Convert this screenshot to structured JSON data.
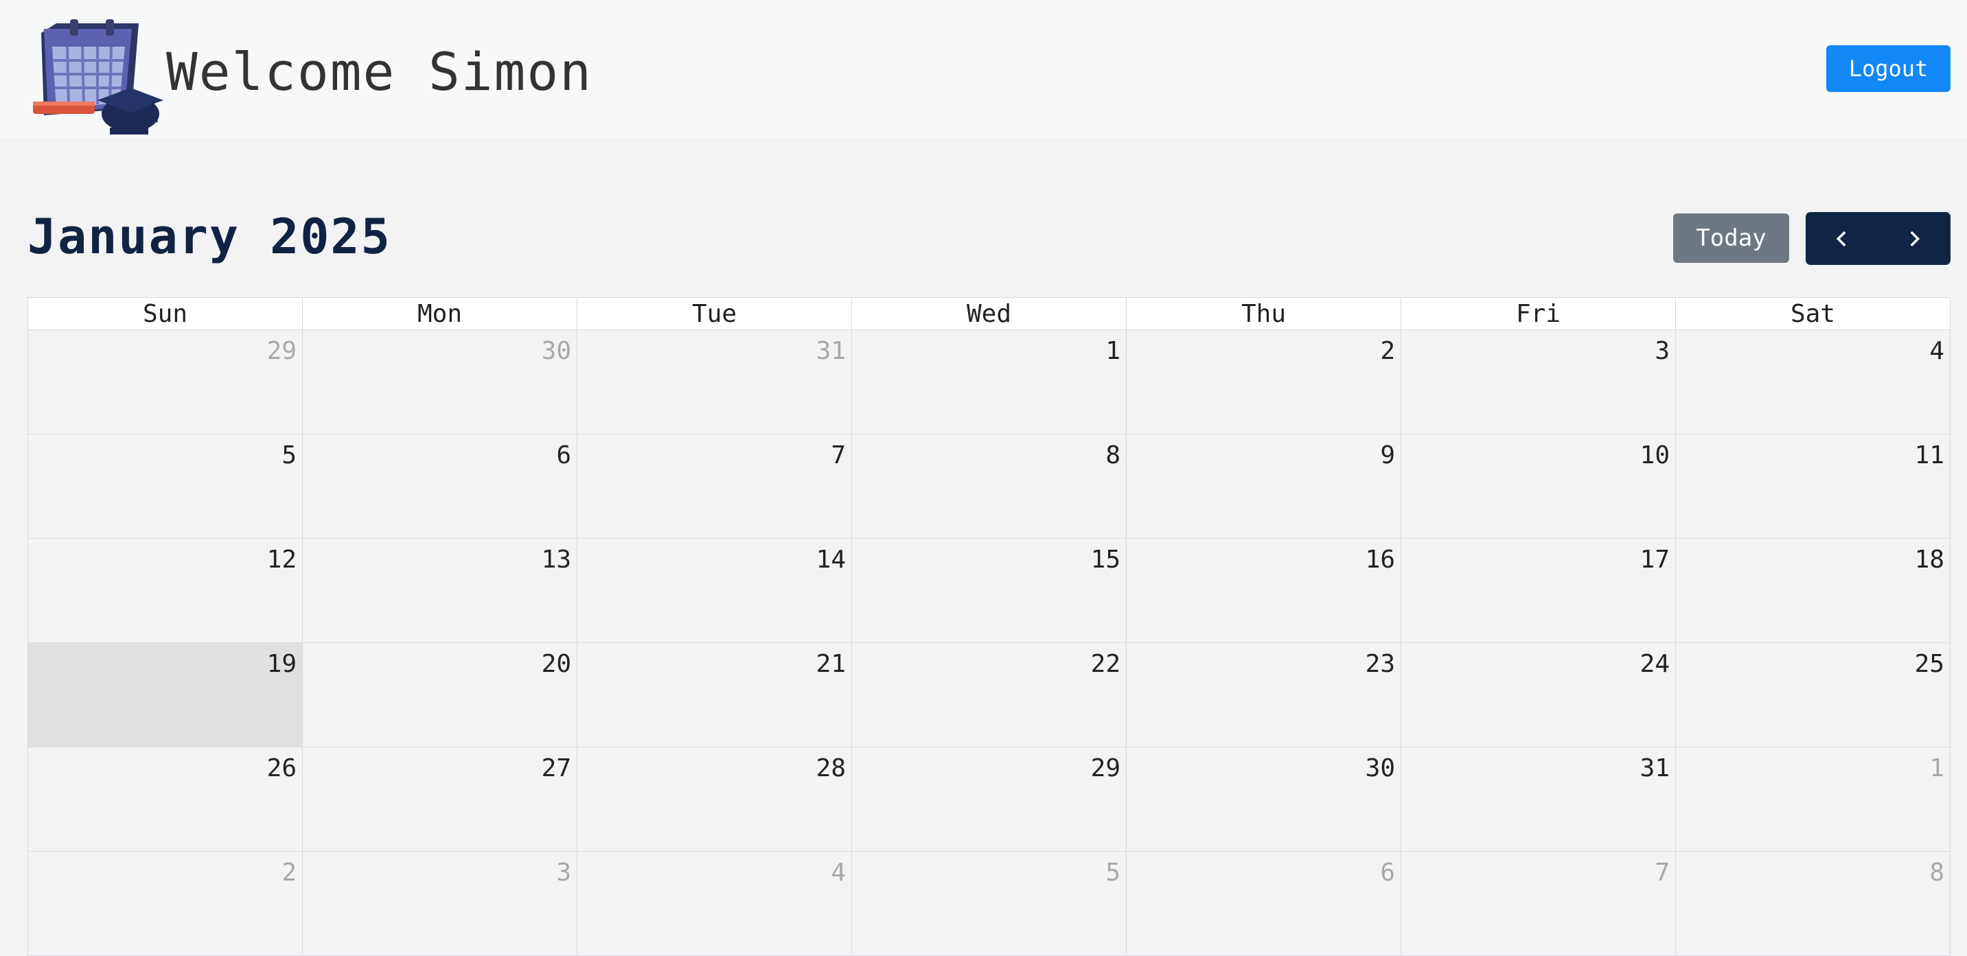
{
  "header": {
    "welcome_text": "Welcome Simon",
    "logout_label": "Logout",
    "logo_icon": "calendar-with-graduation-cap-icon"
  },
  "calendar": {
    "title": "January 2025",
    "today_label": "Today",
    "prev_icon": "chevron-left-icon",
    "next_icon": "chevron-right-icon",
    "weekdays": [
      "Sun",
      "Mon",
      "Tue",
      "Wed",
      "Thu",
      "Fri",
      "Sat"
    ],
    "weeks": [
      [
        {
          "d": "29",
          "other": true
        },
        {
          "d": "30",
          "other": true
        },
        {
          "d": "31",
          "other": true
        },
        {
          "d": "1"
        },
        {
          "d": "2"
        },
        {
          "d": "3"
        },
        {
          "d": "4"
        }
      ],
      [
        {
          "d": "5"
        },
        {
          "d": "6"
        },
        {
          "d": "7"
        },
        {
          "d": "8"
        },
        {
          "d": "9"
        },
        {
          "d": "10"
        },
        {
          "d": "11"
        }
      ],
      [
        {
          "d": "12"
        },
        {
          "d": "13"
        },
        {
          "d": "14"
        },
        {
          "d": "15"
        },
        {
          "d": "16"
        },
        {
          "d": "17"
        },
        {
          "d": "18"
        }
      ],
      [
        {
          "d": "19",
          "today": true
        },
        {
          "d": "20"
        },
        {
          "d": "21"
        },
        {
          "d": "22"
        },
        {
          "d": "23"
        },
        {
          "d": "24"
        },
        {
          "d": "25"
        }
      ],
      [
        {
          "d": "26"
        },
        {
          "d": "27"
        },
        {
          "d": "28"
        },
        {
          "d": "29"
        },
        {
          "d": "30"
        },
        {
          "d": "31"
        },
        {
          "d": "1",
          "other": true
        }
      ],
      [
        {
          "d": "2",
          "other": true
        },
        {
          "d": "3",
          "other": true
        },
        {
          "d": "4",
          "other": true
        },
        {
          "d": "5",
          "other": true
        },
        {
          "d": "6",
          "other": true
        },
        {
          "d": "7",
          "other": true
        },
        {
          "d": "8",
          "other": true
        }
      ]
    ]
  },
  "colors": {
    "primary": "#1287f6",
    "title": "#112244",
    "nav": "#0f2545",
    "today_button": "#6e7882",
    "today_cell": "#e0e0e0"
  }
}
